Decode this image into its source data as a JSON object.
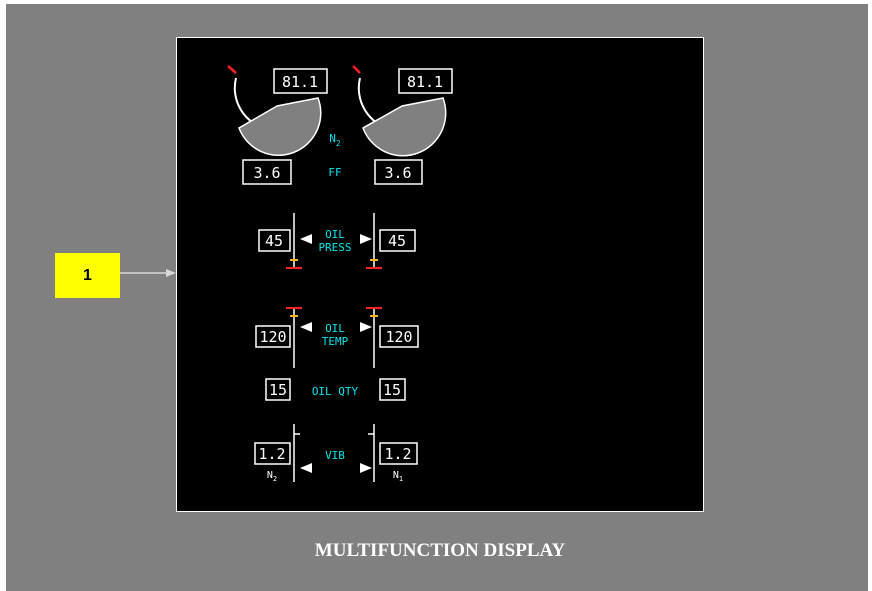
{
  "colors": {
    "cyan": "#00e5ee",
    "white": "#ffffff",
    "red": "#ff2020",
    "amber": "#ffb020",
    "callout": "#ffff00",
    "panel": "#808080"
  },
  "callout": {
    "label": "1"
  },
  "caption": "MULTIFUNCTION DISPLAY",
  "display": {
    "n2": {
      "label_main": "N",
      "label_sub": "2",
      "left": "81.1",
      "right": "81.1"
    },
    "ff": {
      "label": "FF",
      "left": "3.6",
      "right": "3.6"
    },
    "oil_press": {
      "label_line1": "OIL",
      "label_line2": "PRESS",
      "left": "45",
      "right": "45"
    },
    "oil_temp": {
      "label_line1": "OIL",
      "label_line2": "TEMP",
      "left": "120",
      "right": "120"
    },
    "oil_qty": {
      "label": "OIL QTY",
      "left": "15",
      "right": "15"
    },
    "vib": {
      "label": "VIB",
      "left": "1.2",
      "right": "1.2",
      "left_sensor_main": "N",
      "left_sensor_sub": "2",
      "right_sensor_main": "N",
      "right_sensor_sub": "1"
    }
  }
}
